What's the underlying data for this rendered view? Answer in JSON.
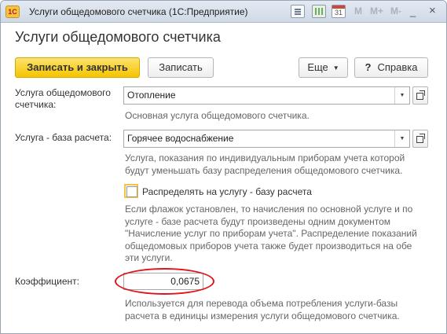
{
  "window": {
    "title": "Услуги общедомового счетчика  (1С:Предприятие)",
    "logo": "1С",
    "controls": {
      "m": "M",
      "m_plus": "M+",
      "m_minus": "M-",
      "minimize": "_",
      "close": "×"
    },
    "calendar_day": "31"
  },
  "form": {
    "heading": "Услуги общедомового счетчика"
  },
  "toolbar": {
    "save_close_label": "Записать и закрыть",
    "save_label": "Записать",
    "more_label": "Еще",
    "help_icon": "?",
    "help_label": "Справка"
  },
  "service": {
    "label": "Услуга общедомового счетчика:",
    "value": "Отопление",
    "hint": "Основная услуга общедомового счетчика."
  },
  "base_service": {
    "label": "Услуга - база расчета:",
    "value": "Горячее водоснабжение",
    "hint": "Услуга, показания по индивидуальным приборам учета которой будут уменьшать базу распределения общедомового счетчика."
  },
  "distribute": {
    "label": "Распределять на услугу - базу расчета",
    "checked": false,
    "hint": "Если флажок установлен, то начисления по основной услуге и по услуге - базе расчета будут произведены одним документом \"Начисление услуг по приборам учета\". Распределение показаний общедомовых приборов учета также будет производиться на обе эти услуги."
  },
  "coefficient": {
    "label": "Коэффициент:",
    "value": "0,0675",
    "hint": "Используется для перевода объема потребления услуги-базы расчета в единицы измерения услуги общедомового счетчика."
  },
  "colors": {
    "primary_button": "#f5c400",
    "highlight": "#e0141a"
  }
}
